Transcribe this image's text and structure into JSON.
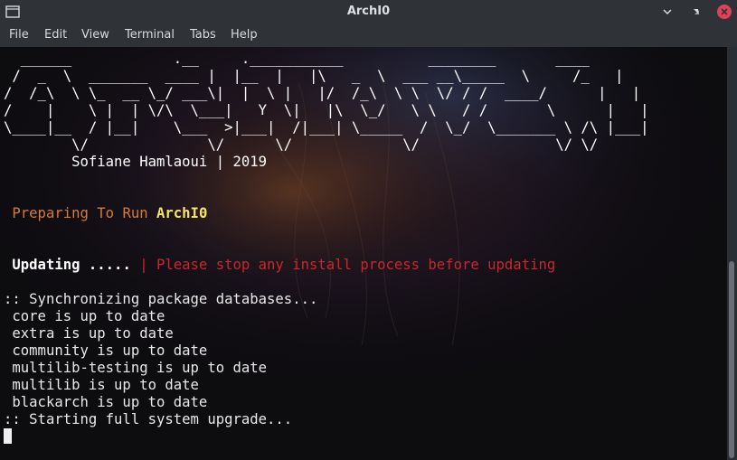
{
  "window": {
    "title": "ArchI0"
  },
  "menu": [
    "File",
    "Edit",
    "View",
    "Terminal",
    "Tabs",
    "Help"
  ],
  "terminal": {
    "banner": [
      "  ______            .__     .___________          ________       ____",
      " /  _  \\  _______  ____ |  |__  |   |\\   _  \\  ___ __\\_____  \\     /_   |",
      "/  /_\\  \\ \\_  __ \\_/ ___\\|  |  \\ |   |/  /_\\  \\ \\  \\/ / /  ____/      |   |",
      "/    |    \\ |  | \\/\\  \\___|   Y  \\|   |\\  \\_/   \\ \\   / /       \\      |   |",
      "\\____|__  / |__|    \\___  >|___|  /|___| \\_____  /  \\_/  \\_______ \\ /\\ |___|",
      "        \\/              \\/      \\/             \\/                \\/ \\/"
    ],
    "author": "        Sofiane Hamlaoui | 2019",
    "preparing_prefix": "Preparing To Run",
    "preparing_name": "ArchI0",
    "updating_label": "Updating .....",
    "updating_warning": "| Please stop any install process before updating",
    "sync_header": ":: Synchronizing package databases...",
    "repos": [
      " core is up to date",
      " extra is up to date",
      " community is up to date",
      " multilib-testing is up to date",
      " multilib is up to date",
      " blackarch is up to date"
    ],
    "upgrade_line": ":: Starting full system upgrade..."
  },
  "colors": {
    "terminal_bg": "#0d0c0f",
    "chrome_bg": "#2f3237",
    "close_button": "#e0405a",
    "orange_text": "#d87a3a",
    "yellow_text": "#f4e46a",
    "red_text": "#c8282a"
  },
  "icons": {
    "app": "terminal-window-icon",
    "minimize": "minimize-icon",
    "maximize": "maximize-icon",
    "close": "close-icon"
  }
}
